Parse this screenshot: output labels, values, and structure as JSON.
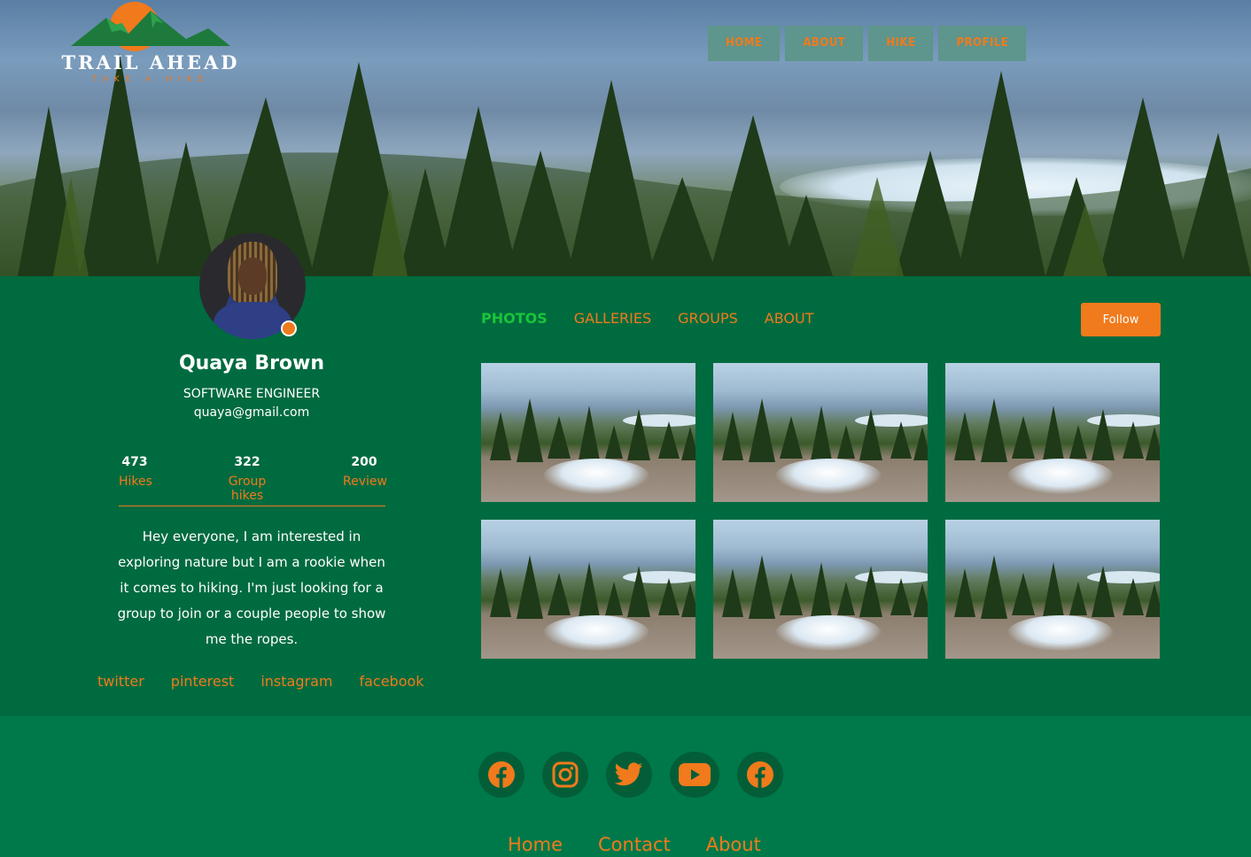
{
  "brand": {
    "title": "TRAIL AHEAD",
    "tagline": "TAKE A HIKE"
  },
  "topnav": [
    "HOME",
    "ABOUT",
    "HIKE",
    "PROFILE"
  ],
  "profile": {
    "name": "Quaya Brown",
    "role": "SOFTWARE ENGINEER",
    "email": "quaya@gmail.com",
    "stats": [
      {
        "value": "473",
        "label": "Hikes"
      },
      {
        "value": "322",
        "label": "Group hikes"
      },
      {
        "value": "200",
        "label": "Review"
      }
    ],
    "bio": "Hey everyone, I am interested in exploring nature but I am a rookie when it comes to hiking. I'm just looking for a group to join or a couple people to show me the ropes.",
    "social": [
      "twitter",
      "pinterest",
      "instagram",
      "facebook"
    ]
  },
  "tabs": [
    {
      "label": "PHOTOS",
      "active": true
    },
    {
      "label": "GALLERIES",
      "active": false
    },
    {
      "label": "GROUPS",
      "active": false
    },
    {
      "label": "ABOUT",
      "active": false
    }
  ],
  "follow_label": "Follow",
  "footer": {
    "icons": [
      "facebook-icon",
      "instagram-icon",
      "twitter-icon",
      "youtube-icon",
      "facebook-icon"
    ],
    "nav": [
      "Home",
      "Contact",
      "About"
    ]
  },
  "colors": {
    "accent": "#f07a1c",
    "green": "#006b3f",
    "footer": "#00794a",
    "active_tab": "#18c53a"
  }
}
